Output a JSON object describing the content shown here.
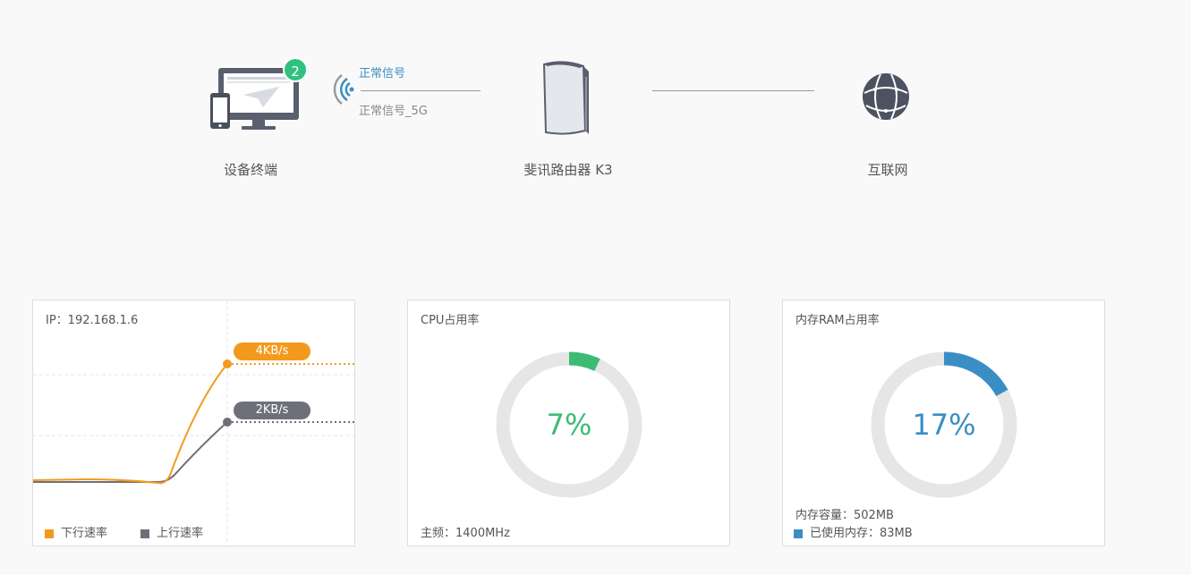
{
  "topology": {
    "device": {
      "label": "设备终端",
      "count": "2"
    },
    "router": {
      "label": "斐讯路由器 K3"
    },
    "internet": {
      "label": "互联网"
    },
    "signal": {
      "band_2g": "正常信号",
      "band_5g": "正常信号_5G"
    }
  },
  "traffic_card": {
    "ip_label": "IP：192.168.1.6",
    "download_rate": "4KB/s",
    "upload_rate": "2KB/s",
    "legend_download": "下行速率",
    "legend_upload": "上行速率",
    "colors": {
      "download": "#f39a1e",
      "upload": "#6e7079"
    }
  },
  "cpu_card": {
    "title": "CPU占用率",
    "value_text": "7%",
    "percent": 7,
    "frequency": "主频：1400MHz",
    "color": "#3dbb73"
  },
  "ram_card": {
    "title": "内存RAM占用率",
    "value_text": "17%",
    "percent": 17,
    "capacity": "内存容量：502MB",
    "used": "已使用内存：83MB",
    "color": "#3a8ec5"
  }
}
